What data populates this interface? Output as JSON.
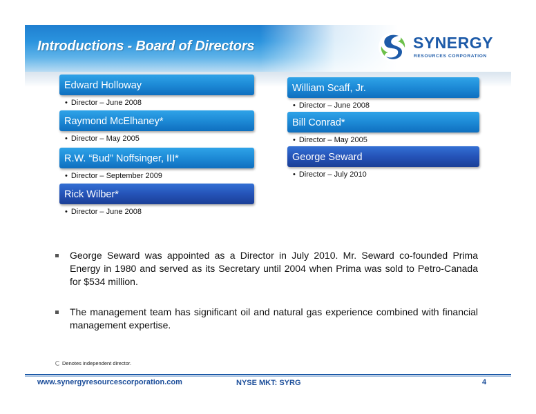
{
  "title": "Introductions - Board of Directors",
  "logo": {
    "icon": "synergy-s-swirl-icon",
    "name": "SYNERGY",
    "subtitle": "RESOURCES CORPORATION"
  },
  "directors_left": [
    {
      "name": "Edward Holloway",
      "since": "Director – June 2008"
    },
    {
      "name": "Raymond McElhaney*",
      "since": "Director – May 2005"
    },
    {
      "name": "R.W. “Bud” Noffsinger, III*",
      "since": "Director – September 2009"
    },
    {
      "name": "Rick Wilber*",
      "since": "Director – June 2008"
    }
  ],
  "directors_right": [
    {
      "name": "William Scaff, Jr.",
      "since": "Director – June 2008"
    },
    {
      "name": "Bill Conrad*",
      "since": "Director – May 2005"
    },
    {
      "name": "George Seward",
      "since": "Director – July 2010"
    }
  ],
  "bullets": [
    "George Seward was appointed as a Director in July 2010. Mr. Seward co-founded Prima Energy in 1980 and served as its Secretary until 2004 when Prima was sold to Petro-Canada for $534 million.",
    "The management team has significant oil and natural gas experience combined with financial management expertise."
  ],
  "footnote": "Denotes independent director.",
  "footer": {
    "url": "www.synergyresourcescorporation.com",
    "ticker": "NYSE MKT: SYRG",
    "page": "4"
  },
  "colors": {
    "title_blue": "#1f7fd0",
    "bar_light": "#1d8ad6",
    "bar_dark": "#2553b8",
    "brand_blue": "#1c5aa8",
    "logo_green": "#6cc04a"
  }
}
